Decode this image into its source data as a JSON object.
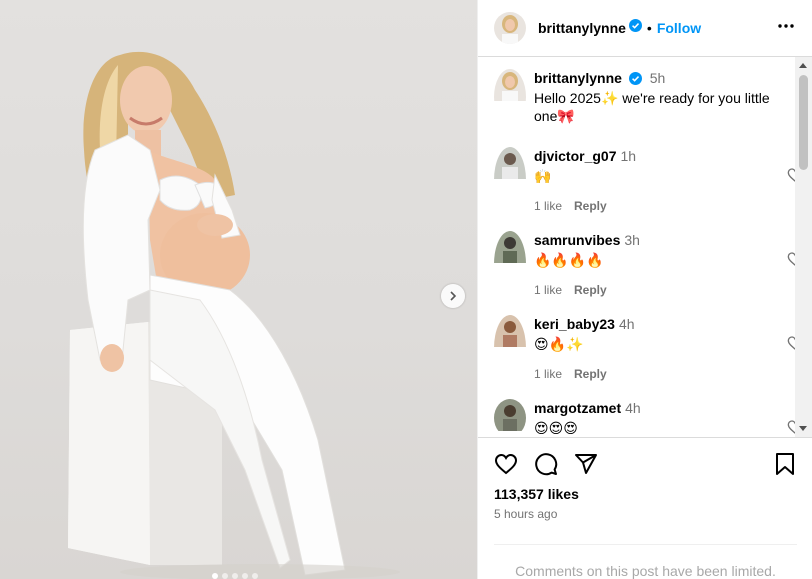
{
  "post": {
    "username": "brittanylynne",
    "follow_label": "Follow",
    "separator": "•",
    "caption_time": "5h",
    "caption_text": "Hello 2025✨ we're ready for you little one🎀",
    "likes": "113,357 likes",
    "posted_ago": "5 hours ago",
    "comments_limited": "Comments on this post have been limited.",
    "carousel_count": 5,
    "carousel_active": 0
  },
  "comments": [
    {
      "user": "djvictor_g07",
      "time": "1h",
      "text": "🙌",
      "likes": "1 like",
      "reply": "Reply"
    },
    {
      "user": "samrunvibes",
      "time": "3h",
      "text": "🔥🔥🔥🔥",
      "likes": "1 like",
      "reply": "Reply"
    },
    {
      "user": "keri_baby23",
      "time": "4h",
      "text": "😍🔥✨",
      "likes": "1 like",
      "reply": "Reply"
    },
    {
      "user": "margotzamet",
      "time": "4h",
      "text": "😍😍😍",
      "likes": "",
      "reply": ""
    }
  ],
  "icons": {
    "verified": "verified-badge-icon",
    "more": "more-options-icon",
    "next": "chevron-right-icon",
    "like": "heart-icon",
    "comment": "comment-bubble-icon",
    "share": "paper-plane-icon",
    "save": "bookmark-icon"
  },
  "colors": {
    "accent": "#0095f6",
    "secondary_text": "#737373",
    "border": "#dbdbdb"
  }
}
